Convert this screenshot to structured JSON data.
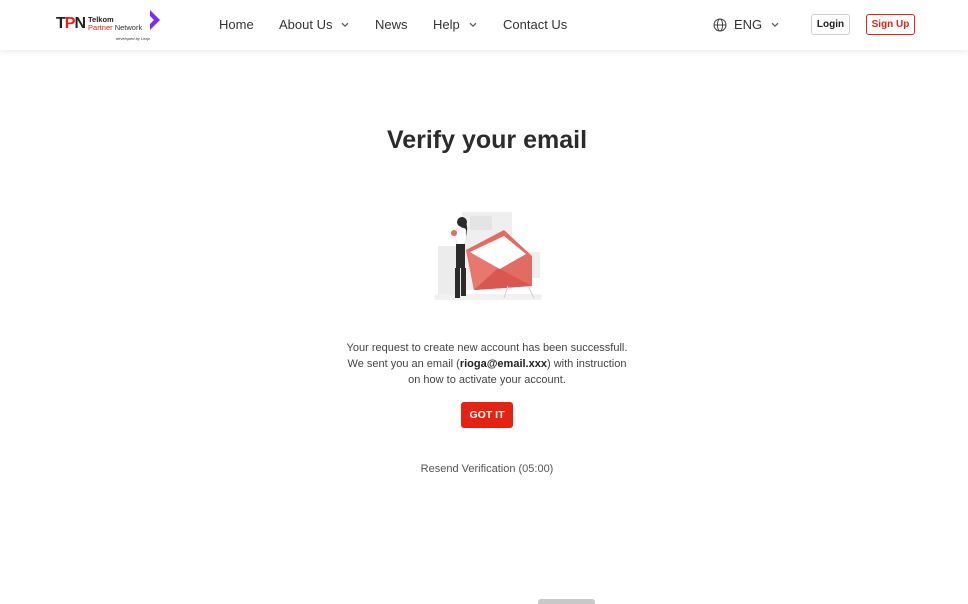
{
  "header": {
    "logo": {
      "mark_t": "T",
      "mark_p": "P",
      "mark_n": "N",
      "line1": "Telkom",
      "line2_a": "Partner",
      "line2_b": "Network",
      "tagline": "developed by Leap"
    },
    "nav": {
      "home": "Home",
      "about": "About Us",
      "news": "News",
      "help": "Help",
      "contact": "Contact Us"
    },
    "language": "ENG",
    "login_label": "Login",
    "signup_label": "Sign Up"
  },
  "main": {
    "title": "Verify your email",
    "message_line1": "Your request to create new account has been successfull.",
    "message_line2_pre": "We sent you an email (",
    "email": "rioga@email.xxx",
    "message_line2_post": ") with instruction",
    "message_line3": "on how to activate your account.",
    "button_label": "GOT IT",
    "resend_label": "Resend Verification (05:00)"
  },
  "colors": {
    "brand_red": "#e42313",
    "brand_purple": "#7b2cf0"
  },
  "icons": {
    "language": "globe-icon",
    "dropdown": "chevron-down-icon",
    "logo_arrow": "chevron-right-icon",
    "illustration": "envelope-illustration"
  }
}
